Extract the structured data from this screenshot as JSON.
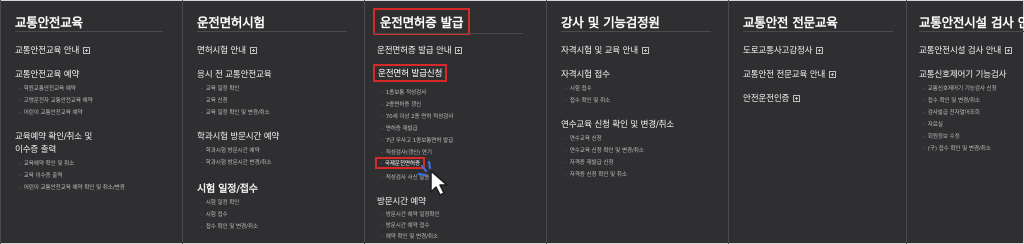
{
  "menu": {
    "col1": {
      "title": "교통안전교육",
      "link1": "교통안전교육 안내",
      "group1": "교통안전교육 예약",
      "g1_items": [
        "학원교통안전교육 예약",
        "고령운전자 교통안전교육 예약",
        "어린이 교통안전교육 예약"
      ],
      "group2_line1": "교육예약 확인/취소 및",
      "group2_line2": "이수증 출력",
      "g2_items": [
        "교육예약 확인 및 취소",
        "교육 이수증 출력",
        "어린이 교통안전교육 예약 확인 및 취소/변경"
      ]
    },
    "col2": {
      "title": "운전면허시험",
      "link1": "면허시험 안내",
      "group1": "응시 전 교통안전교육",
      "g1_items": [
        "교육 일정 확인",
        "교육 신청",
        "교육 일정 확인 및 변경/취소"
      ],
      "group2": "학과시험 방문시간 예약",
      "g2_items": [
        "학과시험 방문시간 예약",
        "학과시험 방문시간 변경/취소"
      ],
      "group3": "시험 일정/접수",
      "g3_items": [
        "시험 일정 확인",
        "시험 접수",
        "접수 확인 및 변경/취소"
      ]
    },
    "col3": {
      "title": "운전면허증 발급",
      "link1": "운전면허증 발급 안내",
      "group1": "운전면허 발급신청",
      "g1_items": [
        "1종보통 적성검사",
        "2종면허증 갱신",
        "70세 이상 2종 면허 적성검사",
        "면허증 재발급",
        "7년 무사고 1종보통면허 발급",
        "적성검사(갱신) 연기",
        "국제운전면허증",
        "적성검사 서신 발송"
      ],
      "group2": "방문시간 예약",
      "g2_items": [
        "방문시간 예약 일정확인",
        "방문시간 예약 접수",
        "예약 확인 및 변경/취소"
      ]
    },
    "col4": {
      "title": "강사 및 기능검정원",
      "link1": "자격시험 및 교육 안내",
      "group1": "자격시험 접수",
      "g1_items": [
        "시험 접수",
        "접수 확인 및 취소"
      ],
      "group2": "연수교육 신청 확인 및 변경/취소",
      "g2_items": [
        "연수교육 신청",
        "연수교육 신청 확인 및 변경/취소",
        "자격증 재발급 신청",
        "자격증 신청 확인 및 취소"
      ]
    },
    "col5": {
      "title": "교통안전 전문교육",
      "link1": "도로교통사고감정사",
      "link2": "교통안전 전문교육 안내",
      "link3": "안전운전인증"
    },
    "col6": {
      "title": "교통안전시설 검사 안내",
      "link1": "교통안전시설 검사 안내",
      "group1": "교통신호제어기 기능검사",
      "g1_items": [
        "교통신호제어기 기능검사 신청",
        "접수 확인 및 변경/취소",
        "검사발급 전자열어조회",
        "자료실",
        "회원정보 수정",
        "(구) 접수 확인 및 변경/취소"
      ]
    }
  },
  "colors": {
    "background": "#2f2f31",
    "highlight": "#d52a2a",
    "cursor_accent": "#3d6fd8"
  }
}
